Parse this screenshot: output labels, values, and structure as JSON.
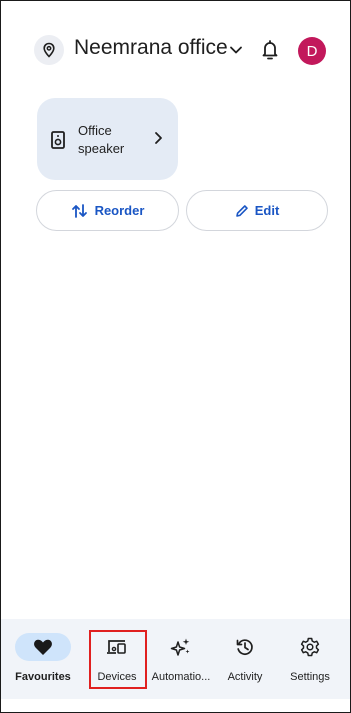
{
  "header": {
    "home_name": "Neemrana office",
    "avatar_initial": "D"
  },
  "tiles": [
    {
      "label": "Office speaker",
      "icon": "speaker-icon"
    }
  ],
  "actions": {
    "reorder_label": "Reorder",
    "edit_label": "Edit"
  },
  "bottom_nav": {
    "items": [
      {
        "label": "Favourites",
        "icon": "heart-icon",
        "active": true
      },
      {
        "label": "Devices",
        "icon": "devices-icon",
        "active": false,
        "highlighted": true
      },
      {
        "label": "Automatio...",
        "icon": "sparkle-icon",
        "active": false
      },
      {
        "label": "Activity",
        "icon": "history-icon",
        "active": false
      },
      {
        "label": "Settings",
        "icon": "gear-icon",
        "active": false
      }
    ]
  },
  "colors": {
    "accent_blue": "#1a56c4",
    "avatar_bg": "#c2185b",
    "tile_bg": "#e4ebf5",
    "nav_bg": "#f1f4f9",
    "active_pill": "#cfe4fb",
    "highlight_box": "#e02020"
  }
}
